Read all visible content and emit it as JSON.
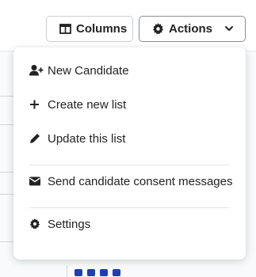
{
  "toolbar": {
    "columns_label": "Columns",
    "actions_label": "Actions"
  },
  "actions_menu": {
    "items": [
      {
        "label": "New Candidate",
        "icon": "user-plus-icon"
      },
      {
        "label": "Create new list",
        "icon": "plus-icon"
      },
      {
        "label": "Update this list",
        "icon": "pencil-icon"
      },
      {
        "label": "Send candidate consent messages",
        "icon": "envelope-icon"
      },
      {
        "label": "Settings",
        "icon": "gear-icon"
      }
    ]
  },
  "colors": {
    "text": "#222222",
    "border": "#c9cdd3",
    "accent_icon": "#1e40af"
  }
}
